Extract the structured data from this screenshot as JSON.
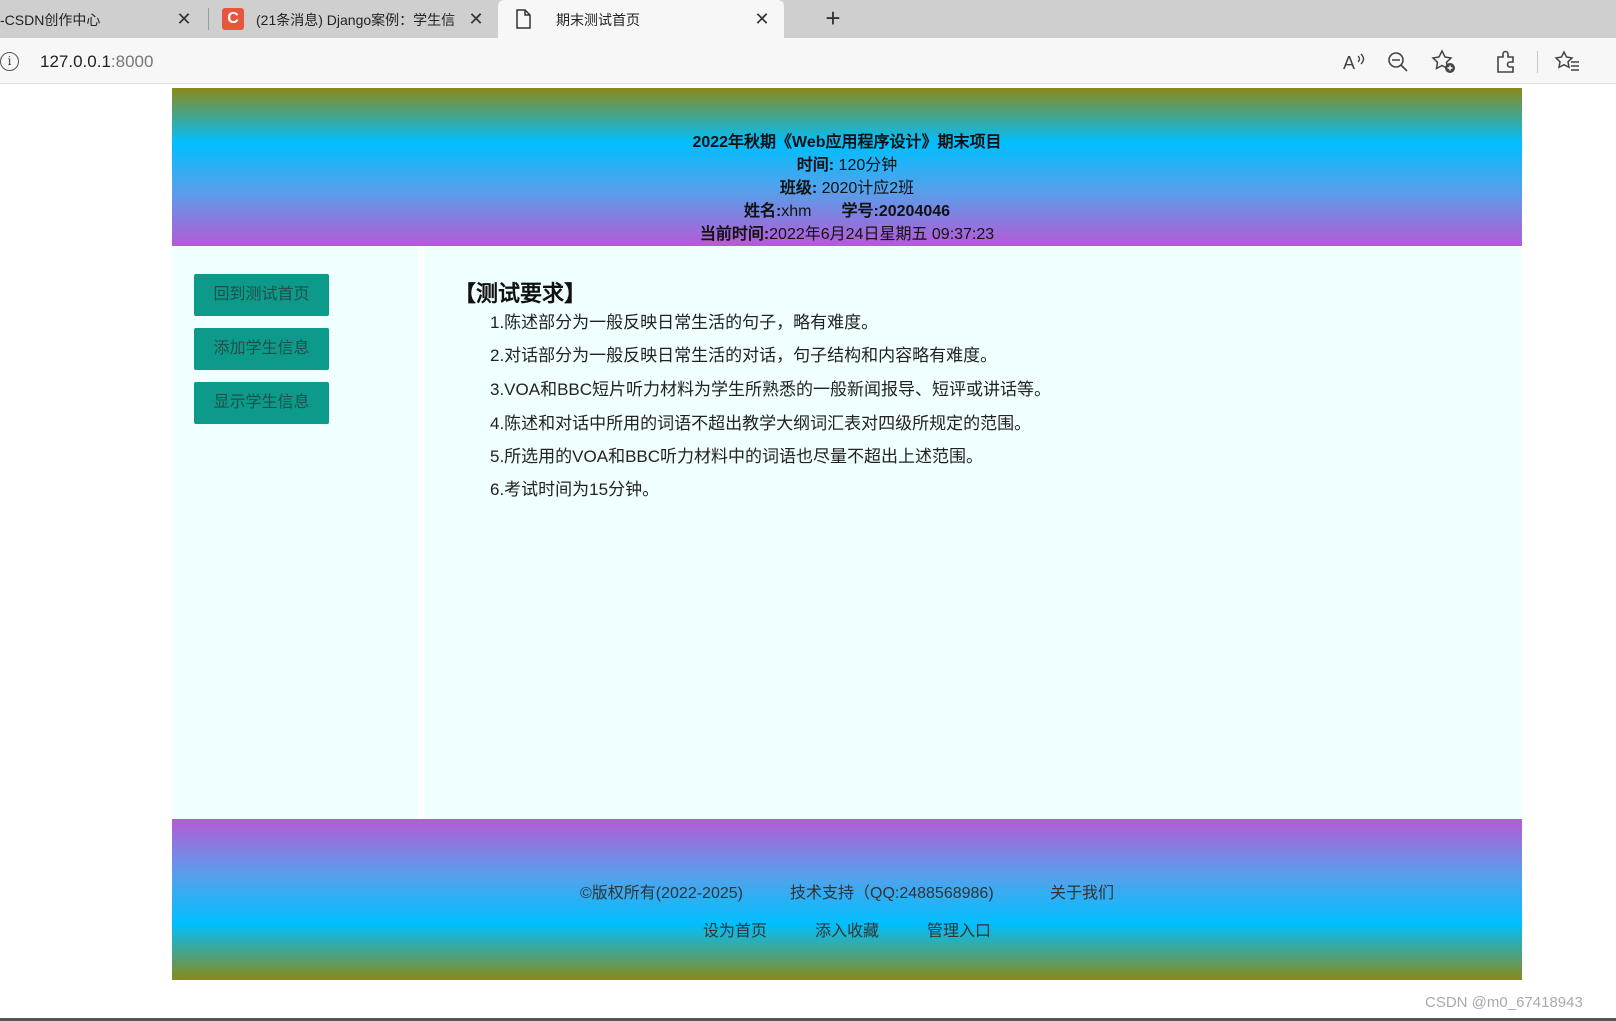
{
  "browser": {
    "tabs": [
      {
        "title": "-CSDN创作中心",
        "close": "✕"
      },
      {
        "title": "(21条消息) Django案例：学生信",
        "close": "✕",
        "badge": "C"
      },
      {
        "title": "期末测试首页",
        "close": "✕"
      }
    ],
    "new_tab": "+",
    "address": {
      "host": "127.0.0.1",
      "port": ":8000",
      "info": "i"
    }
  },
  "header": {
    "title": "2022年秋期《Web应用程序设计》期末项目",
    "time_label": "时间:",
    "time_value": "120分钟",
    "class_label": "班级:",
    "class_value": "2020计应2班",
    "name_label": "姓名:",
    "name_value": "xhm",
    "id_label": "学号:",
    "id_value": "20204046",
    "now_label": "当前时间:",
    "now_value": "2022年6月24日星期五 09:37:23"
  },
  "sidebar": {
    "items": [
      {
        "label": "回到测试首页"
      },
      {
        "label": "添加学生信息"
      },
      {
        "label": "显示学生信息"
      }
    ]
  },
  "content": {
    "heading": "【测试要求】",
    "requirements": [
      "1.陈述部分为一般反映日常生活的句子，略有难度。",
      "2.对话部分为一般反映日常生活的对话，句子结构和内容略有难度。",
      "3.VOA和BBC短片听力材料为学生所熟悉的一般新闻报导、短评或讲话等。",
      "4.陈述和对话中所用的词语不超出教学大纲词汇表对四级所规定的范围。",
      "5.所选用的VOA和BBC听力材料中的词语也尽量不超出上述范围。",
      "6.考试时间为15分钟。"
    ]
  },
  "footer": {
    "copyright": "©版权所有(2022-2025)",
    "support": "技术支持（QQ:2488568986)",
    "about": "关于我们",
    "set_home": "设为首页",
    "favorite": "添入收藏",
    "admin": "管理入口"
  },
  "watermark": "CSDN @m0_67418943",
  "colors": {
    "accent": "#0e9a8a",
    "content_bg": "#f0ffff",
    "gradient_top": "#8a8a1a",
    "gradient_mid": "#00bfff",
    "gradient_bottom": "#b65ad6"
  }
}
